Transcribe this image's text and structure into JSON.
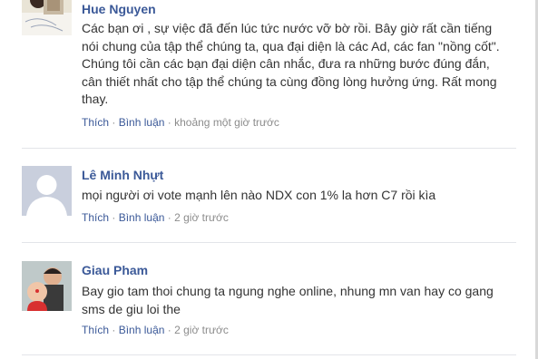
{
  "comments": [
    {
      "author": "Hue Nguyen",
      "text": "Các bạn ơi , sự việc đã đến lúc tức nước vỡ bờ rồi. Bây giờ rất cần tiếng nói chung của tập thể chúng ta, qua đại diện là các Ad, các fan \"nồng cốt\". Chúng tôi cần các bạn đại diện cân nhắc, đưa ra những bước đúng đắn, cân thiết nhất cho tập thể chúng ta cùng đồng lòng hưởng ứng. Rất mong thay.",
      "like": "Thích",
      "reply": "Bình luận",
      "sep": "·",
      "time": "khoảng một giờ trước"
    },
    {
      "author": "Lê Minh Nhựt",
      "text": "mọi người ơi vote mạnh lên nào NDX con 1% la hơn C7 rồi kìa",
      "like": "Thích",
      "reply": "Bình luận",
      "sep": "·",
      "time": "2 giờ trước"
    },
    {
      "author": "Giau Pham",
      "text": "Bay gio tam thoi chung ta ngung nghe online, nhung mn van hay co gang sms de giu loi the",
      "like": "Thích",
      "reply": "Bình luận",
      "sep": "·",
      "time": "2 giờ trước"
    }
  ],
  "colors": {
    "link": "#3b5998",
    "text": "#333333",
    "meta": "#8c8c8c",
    "divider": "#e3e5e9"
  }
}
